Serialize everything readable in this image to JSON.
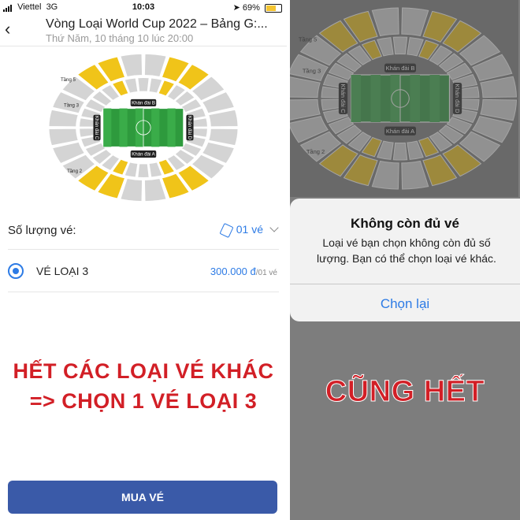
{
  "status_bar": {
    "carrier": "Viettel",
    "network": "3G",
    "time": "10:03",
    "battery": "69%",
    "battery_level": 0.69
  },
  "header": {
    "back_icon": "chevron-left-icon",
    "title": "Vòng Loại World Cup 2022 – Bảng G:...",
    "subtitle": "Thứ Năm, 10 tháng 10 lúc 20:00"
  },
  "stadium": {
    "stands": [
      "Khán đài A",
      "Khán đài B",
      "Khán đài C",
      "Khán đài D"
    ],
    "tiers": [
      "Tầng 2",
      "Tầng 3",
      "Tầng 5"
    ],
    "colors": {
      "pitch": "#2e9a3d",
      "sold_out": "#d4d4d4",
      "available": "#f0c419"
    }
  },
  "quantity": {
    "label": "Số lượng vé:",
    "value": "01 vé"
  },
  "ticket": {
    "name": "VÉ LOẠI 3",
    "price": "300.000 đ",
    "unit": "/01 vé"
  },
  "caption_left": {
    "line1": "HẾT CÁC LOẠI VÉ KHÁC",
    "line2": "=> CHỌN 1 VÉ LOẠI 3"
  },
  "buy_button": {
    "label": "MUA VÉ"
  },
  "dialog": {
    "title": "Không còn đủ vé",
    "message": "Loại vé bạn chọn không còn đủ số lượng. Bạn có thể chọn loại vé khác.",
    "button": "Chọn lại"
  },
  "caption_right": "CŨNG HẾT",
  "colors": {
    "accent": "#2d7be5",
    "button_bg": "#3a5aa8",
    "caption_red": "#d21f26"
  }
}
